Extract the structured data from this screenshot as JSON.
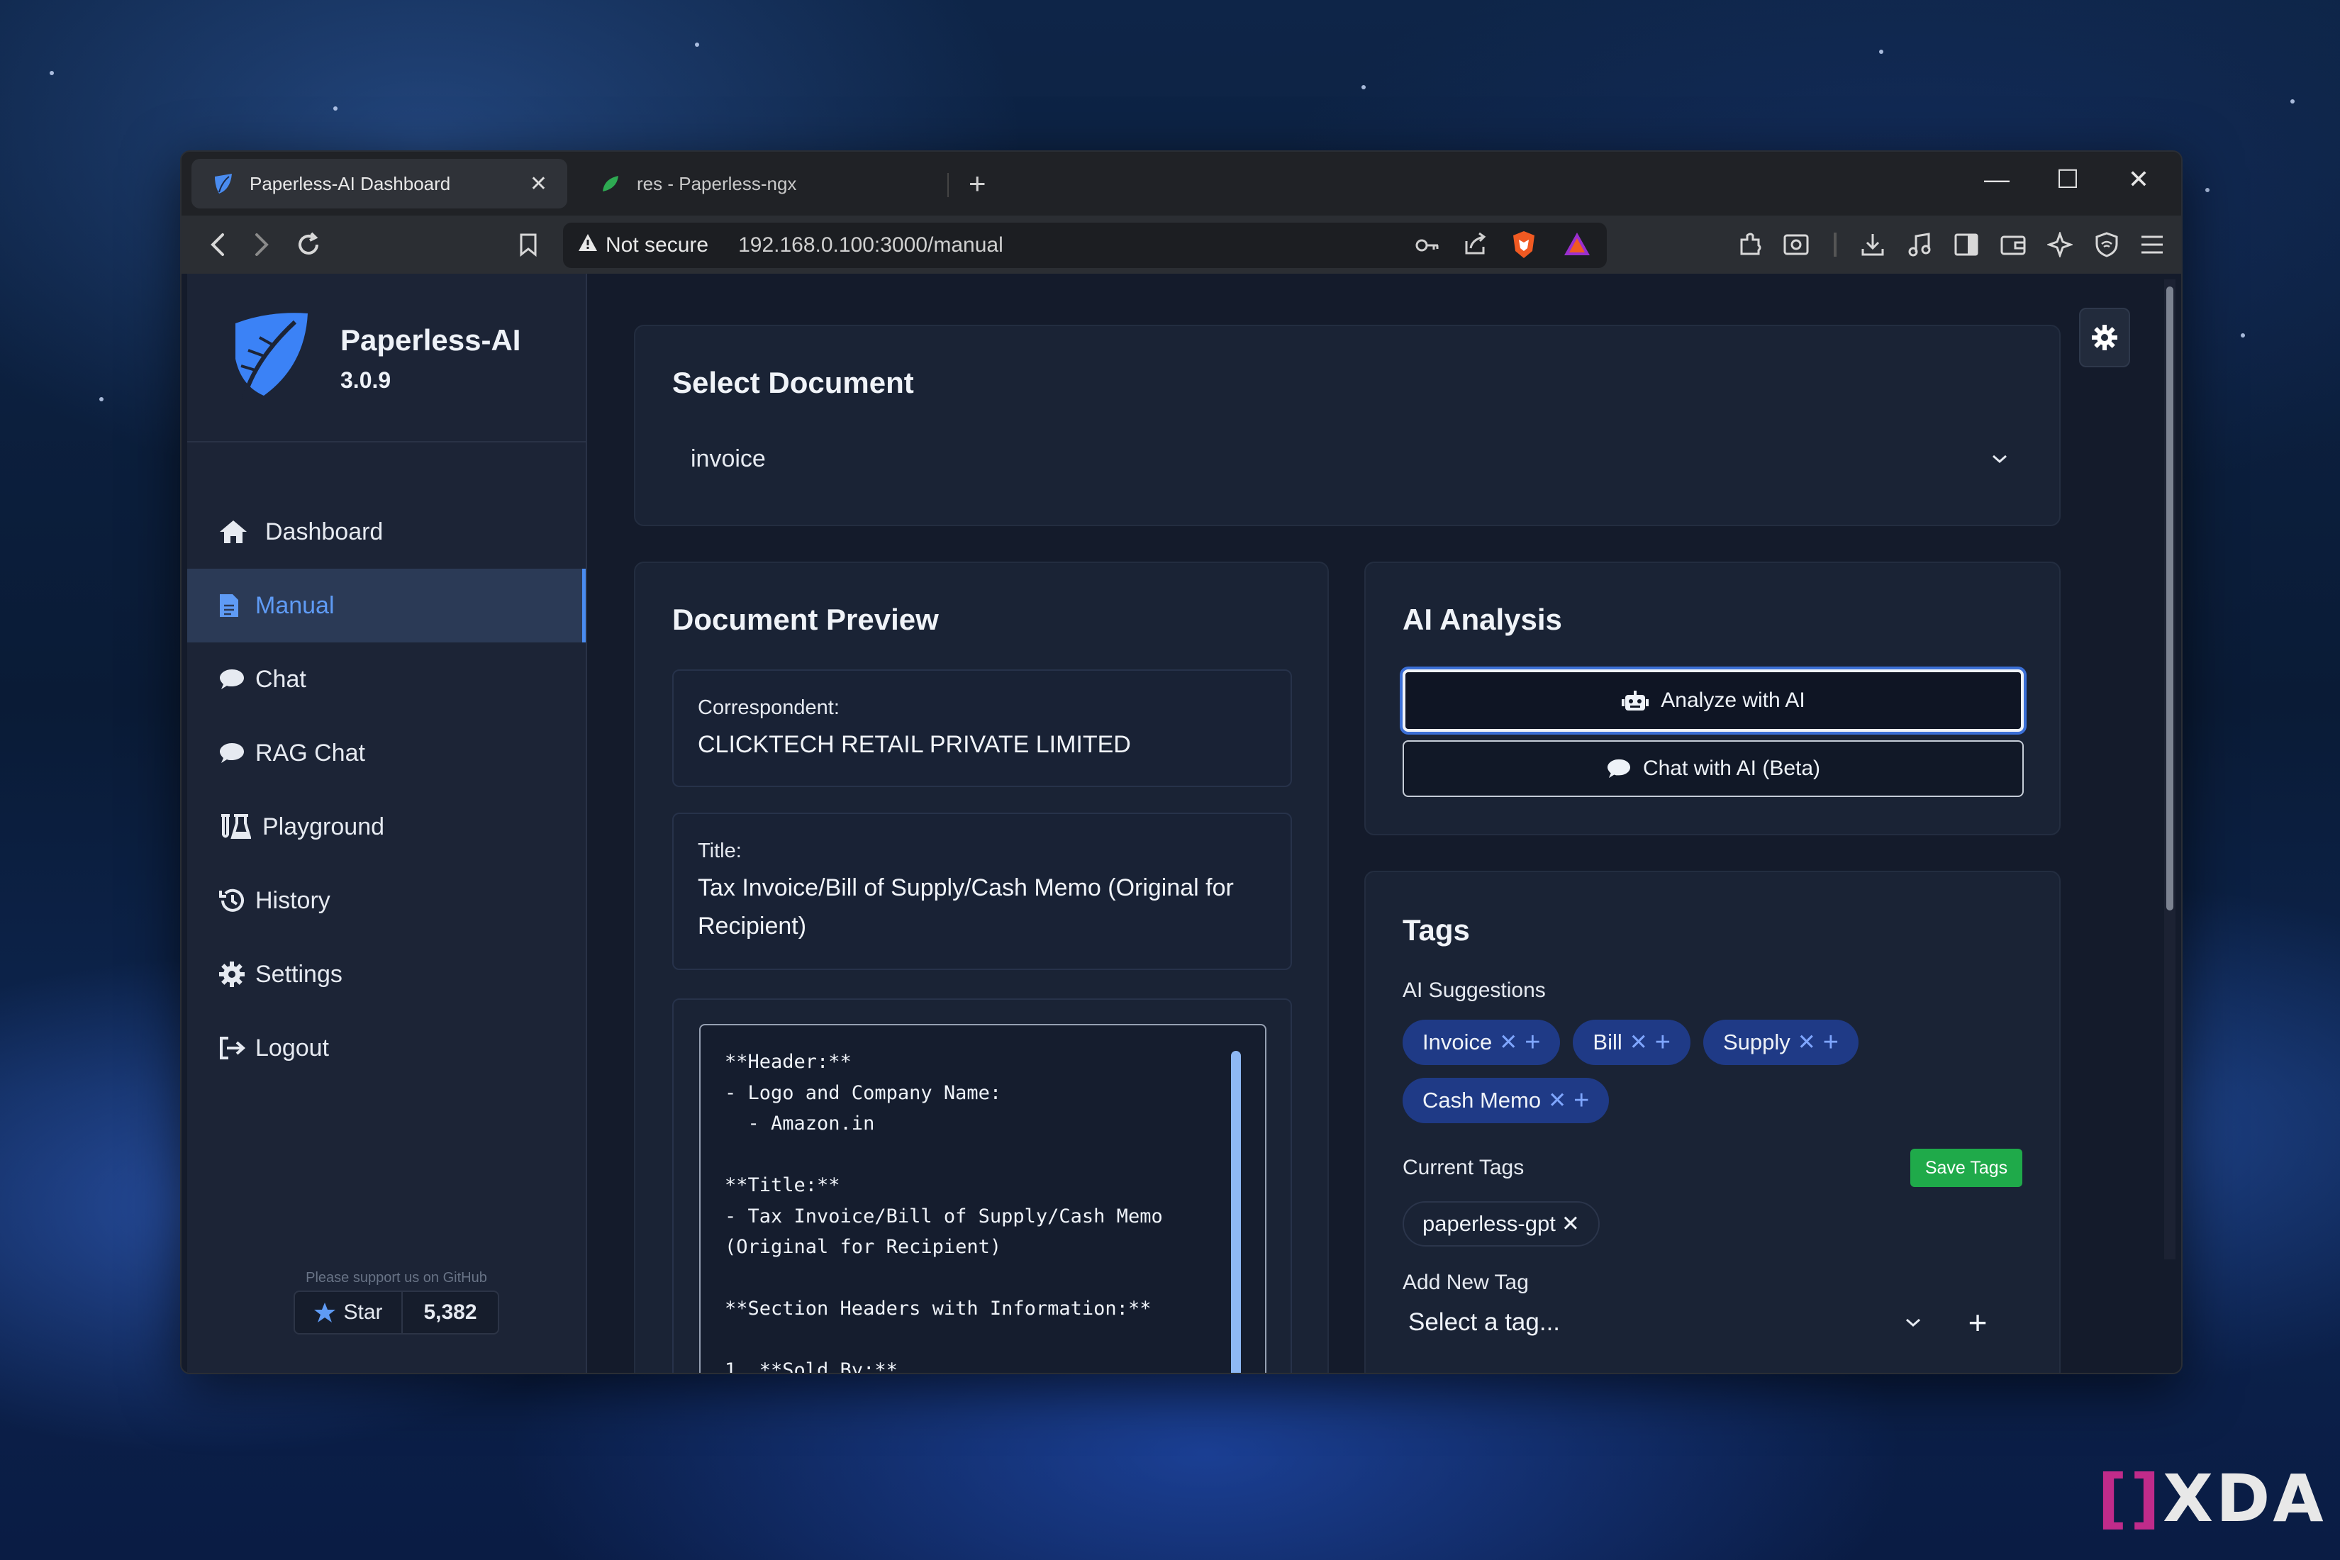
{
  "browser": {
    "tabs": [
      {
        "title": "Paperless-AI Dashboard",
        "active": true
      },
      {
        "title": "res - Paperless-ngx",
        "active": false
      }
    ],
    "new_tab": "+",
    "security_label": "Not secure",
    "url": "192.168.0.100:3000/manual",
    "controls": {
      "minimize": "—",
      "maximize": "☐",
      "close": "✕"
    }
  },
  "sidebar": {
    "app_name": "Paperless-AI",
    "version": "3.0.9",
    "items": [
      {
        "label": "Dashboard",
        "icon": "home-icon"
      },
      {
        "label": "Manual",
        "icon": "document-icon",
        "active": true
      },
      {
        "label": "Chat",
        "icon": "chat-bubble-icon"
      },
      {
        "label": "RAG Chat",
        "icon": "chat-bubble-icon"
      },
      {
        "label": "Playground",
        "icon": "flask-icon"
      },
      {
        "label": "History",
        "icon": "history-icon"
      },
      {
        "label": "Settings",
        "icon": "gear-icon"
      },
      {
        "label": "Logout",
        "icon": "logout-icon"
      }
    ],
    "support_text": "Please support us on GitHub",
    "star_label": "Star",
    "star_count": "5,382"
  },
  "select_document": {
    "heading": "Select Document",
    "value": "invoice"
  },
  "preview": {
    "heading": "Document Preview",
    "correspondent_label": "Correspondent:",
    "correspondent_value": "CLICKTECH RETAIL PRIVATE LIMITED",
    "title_label": "Title:",
    "title_value": "Tax Invoice/Bill of Supply/Cash Memo (Original for Recipient)",
    "content": "**Header:**\n- Logo and Company Name:\n  - Amazon.in\n\n**Title:**\n- Tax Invoice/Bill of Supply/Cash Memo\n(Original for Recipient)\n\n**Section Headers with Information:**\n\n1. **Sold By:**"
  },
  "ai_analysis": {
    "heading": "AI Analysis",
    "analyze_label": "Analyze with AI",
    "chat_label": "Chat with AI (Beta)"
  },
  "tags": {
    "heading": "Tags",
    "suggestions_label": "AI Suggestions",
    "suggestions": [
      "Invoice",
      "Bill",
      "Supply",
      "Cash Memo"
    ],
    "current_label": "Current Tags",
    "save_label": "Save Tags",
    "current": [
      "paperless-gpt"
    ],
    "add_label": "Add New Tag",
    "add_placeholder": "Select a tag...",
    "add_button": "+"
  },
  "watermark": "XDA",
  "colors": {
    "accent": "#4a8cf0",
    "chip_bg": "#1f3a86",
    "save_green": "#1faa4a",
    "panel_bg": "#1a2335"
  }
}
